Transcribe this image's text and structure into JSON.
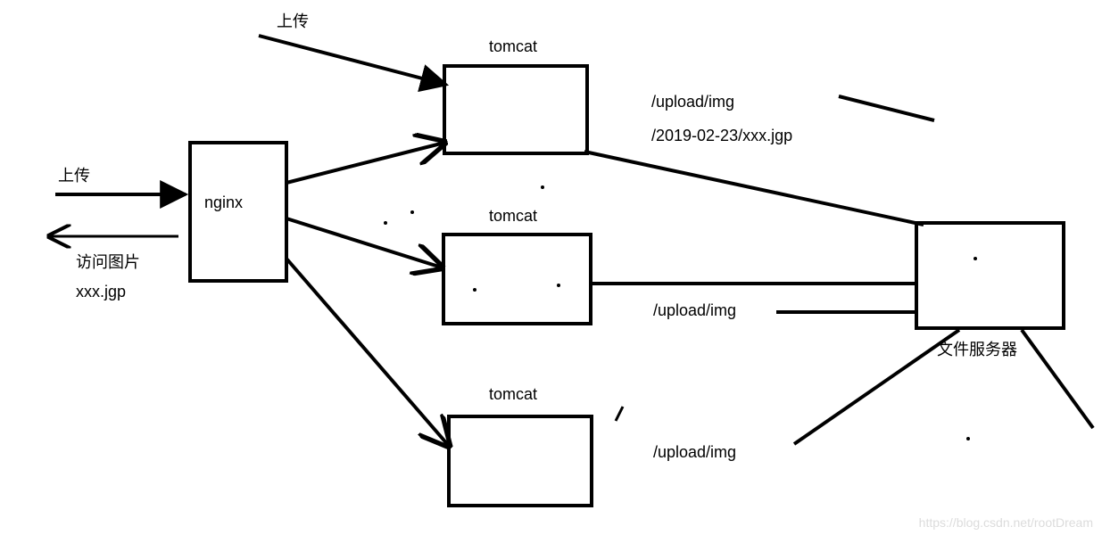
{
  "labels": {
    "upload_top": "上传",
    "upload_left": "上传",
    "access_img_line1": "访问图片",
    "access_img_line2": "xxx.jgp",
    "nginx_label": "nginx",
    "tomcat_top": "tomcat",
    "tomcat_mid": "tomcat",
    "tomcat_bot": "tomcat",
    "path1_line1": "/upload/img",
    "path1_line2": "/2019-02-23/xxx.jgp",
    "path2": "/upload/img",
    "path3": "/upload/img",
    "file_server": "文件服务器"
  },
  "watermark": "https://blog.csdn.net/rootDream"
}
